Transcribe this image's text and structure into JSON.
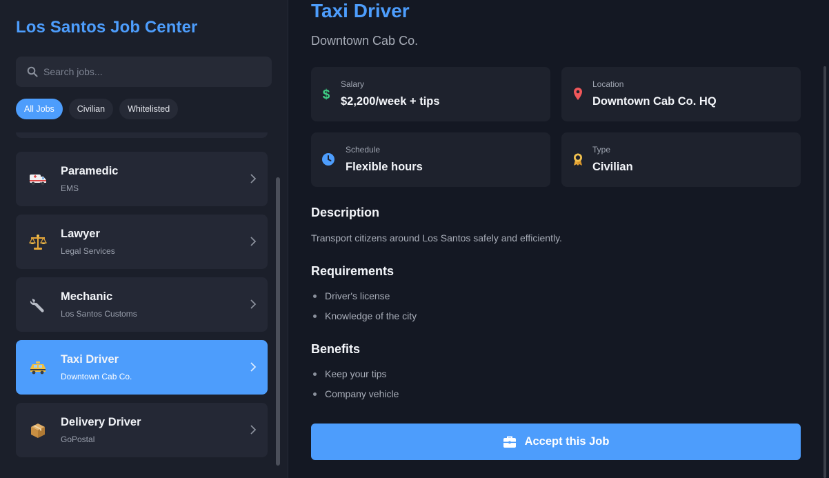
{
  "app": {
    "title": "Los Santos Job Center"
  },
  "search": {
    "placeholder": "Search jobs..."
  },
  "filters": [
    "All Jobs",
    "Civilian",
    "Whitelisted"
  ],
  "jobs": [
    {
      "title": "Paramedic",
      "subtitle": "EMS",
      "icon": "ambulance-icon"
    },
    {
      "title": "Lawyer",
      "subtitle": "Legal Services",
      "icon": "scales-icon"
    },
    {
      "title": "Mechanic",
      "subtitle": "Los Santos Customs",
      "icon": "wrench-icon"
    },
    {
      "title": "Taxi Driver",
      "subtitle": "Downtown Cab Co.",
      "icon": "taxi-icon"
    },
    {
      "title": "Delivery Driver",
      "subtitle": "GoPostal",
      "icon": "package-icon"
    }
  ],
  "selected": {
    "title": "Taxi Driver",
    "company": "Downtown Cab Co.",
    "salary": {
      "label": "Salary",
      "value": "$2,200/week + tips",
      "icon": "dollar-icon"
    },
    "location": {
      "label": "Location",
      "value": "Downtown Cab Co. HQ",
      "icon": "map-pin-icon"
    },
    "schedule": {
      "label": "Schedule",
      "value": "Flexible hours",
      "icon": "clock-icon"
    },
    "type": {
      "label": "Type",
      "value": "Civilian",
      "icon": "badge-icon"
    },
    "description_heading": "Description",
    "description": "Transport citizens around Los Santos safely and efficiently.",
    "requirements_heading": "Requirements",
    "requirements": [
      "Driver's license",
      "Knowledge of the city"
    ],
    "benefits_heading": "Benefits",
    "benefits": [
      "Keep your tips",
      "Company vehicle"
    ],
    "accept_label": "Accept this Job"
  },
  "colors": {
    "accent": "#4d9dfc",
    "background": "#141823",
    "sidebar": "#1b1f2a",
    "card": "#1e222d"
  }
}
